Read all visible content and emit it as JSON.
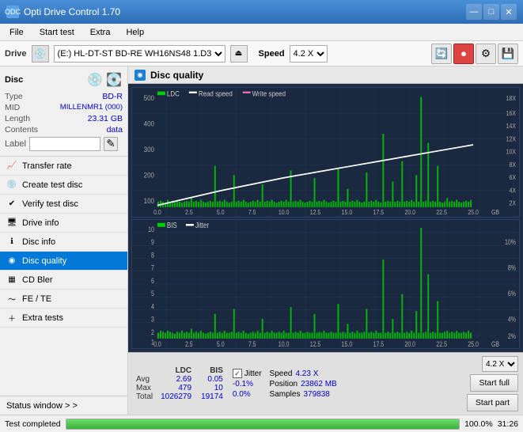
{
  "app": {
    "title": "Opti Drive Control 1.70",
    "icon": "ODC"
  },
  "title_controls": {
    "minimize": "—",
    "maximize": "□",
    "close": "✕"
  },
  "menu": {
    "items": [
      "File",
      "Start test",
      "Extra",
      "Help"
    ]
  },
  "drive_bar": {
    "label": "Drive",
    "drive_value": "(E:) HL-DT-ST BD-RE  WH16NS48 1.D3",
    "speed_label": "Speed",
    "speed_value": "4.2 X"
  },
  "disc_panel": {
    "title": "Disc",
    "type_label": "Type",
    "type_value": "BD-R",
    "mid_label": "MID",
    "mid_value": "MILLENMR1 (000)",
    "length_label": "Length",
    "length_value": "23.31 GB",
    "contents_label": "Contents",
    "contents_value": "data",
    "label_label": "Label"
  },
  "nav": {
    "items": [
      {
        "id": "transfer-rate",
        "label": "Transfer rate",
        "active": false
      },
      {
        "id": "create-test-disc",
        "label": "Create test disc",
        "active": false
      },
      {
        "id": "verify-test-disc",
        "label": "Verify test disc",
        "active": false
      },
      {
        "id": "drive-info",
        "label": "Drive info",
        "active": false
      },
      {
        "id": "disc-info",
        "label": "Disc info",
        "active": false
      },
      {
        "id": "disc-quality",
        "label": "Disc quality",
        "active": true
      },
      {
        "id": "cd-bler",
        "label": "CD Bler",
        "active": false
      },
      {
        "id": "fe-te",
        "label": "FE / TE",
        "active": false
      },
      {
        "id": "extra-tests",
        "label": "Extra tests",
        "active": false
      }
    ],
    "status_window": "Status window > >"
  },
  "disc_quality": {
    "title": "Disc quality",
    "chart1": {
      "legend": [
        {
          "label": "LDC",
          "color": "#00aa00"
        },
        {
          "label": "Read speed",
          "color": "#ffffff"
        },
        {
          "label": "Write speed",
          "color": "#ff69b4"
        }
      ],
      "y_max": 500,
      "y_right_max": 18,
      "x_max": 25,
      "x_labels": [
        "0.0",
        "2.5",
        "5.0",
        "7.5",
        "10.0",
        "12.5",
        "15.0",
        "17.5",
        "20.0",
        "22.5",
        "25.0"
      ],
      "y_labels_left": [
        "500",
        "400",
        "300",
        "200",
        "100"
      ],
      "y_labels_right": [
        "18X",
        "16X",
        "14X",
        "12X",
        "10X",
        "8X",
        "6X",
        "4X",
        "2X"
      ]
    },
    "chart2": {
      "legend": [
        {
          "label": "BIS",
          "color": "#00aa00"
        },
        {
          "label": "Jitter",
          "color": "#ffffff"
        }
      ],
      "y_max": 10,
      "y_right_max": 10,
      "x_max": 25,
      "x_labels": [
        "0.0",
        "2.5",
        "5.0",
        "7.5",
        "10.0",
        "12.5",
        "15.0",
        "17.5",
        "20.0",
        "22.5",
        "25.0"
      ],
      "y_labels_left": [
        "10",
        "9",
        "8",
        "7",
        "6",
        "5",
        "4",
        "3",
        "2",
        "1"
      ],
      "y_labels_right": [
        "10%",
        "8%",
        "6%",
        "4%",
        "2%"
      ]
    }
  },
  "stats": {
    "headers": [
      "",
      "LDC",
      "BIS",
      "",
      "Jitter",
      "Speed",
      "",
      ""
    ],
    "rows": [
      {
        "label": "Avg",
        "ldc": "2.69",
        "bis": "0.05",
        "jitter": "-0.1%",
        "speed_label": "Speed",
        "speed_val": "4.23 X"
      },
      {
        "label": "Max",
        "ldc": "479",
        "bis": "10",
        "jitter": "0.0%",
        "pos_label": "Position",
        "pos_val": "23862 MB"
      },
      {
        "label": "Total",
        "ldc": "1026279",
        "bis": "19174",
        "jitter": "",
        "samp_label": "Samples",
        "samp_val": "379838"
      }
    ],
    "jitter_checked": true,
    "jitter_label": "Jitter",
    "speed_dropdown": "4.2 X",
    "btn_start_full": "Start full",
    "btn_start_part": "Start part"
  },
  "bottom": {
    "status_text": "Test completed",
    "progress": 100,
    "time": "31:26"
  }
}
